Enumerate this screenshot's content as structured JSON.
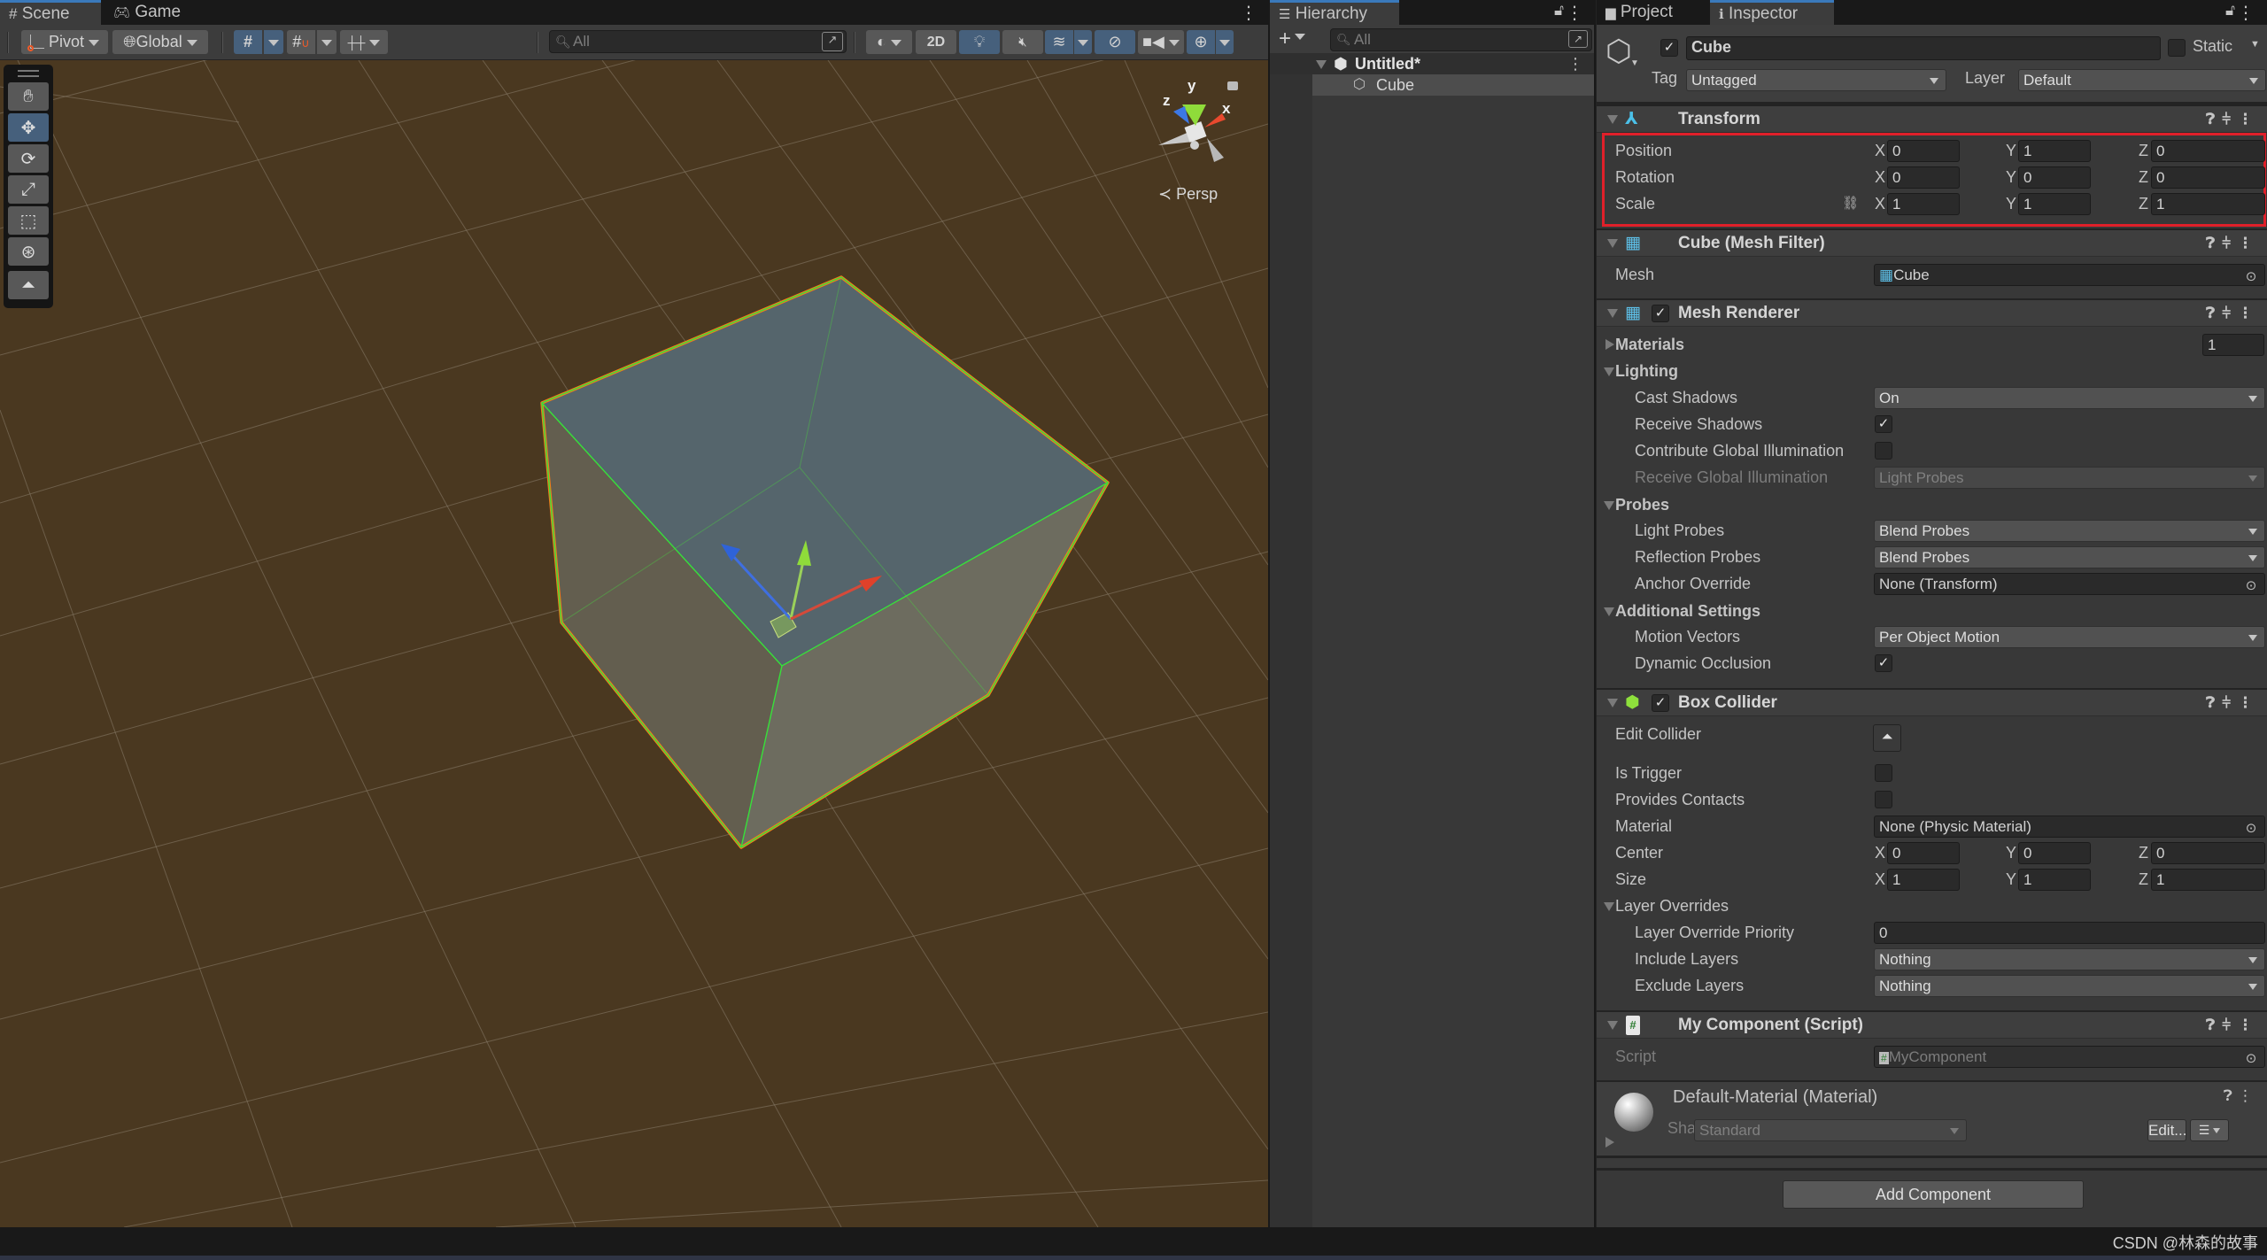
{
  "scene_window": {
    "tabs": [
      {
        "label": "Scene",
        "icon": "grid-hash-icon",
        "active": true
      },
      {
        "label": "Game",
        "icon": "gamepad-icon",
        "active": false
      }
    ],
    "toolbar": {
      "pivot_label": "Pivot",
      "global_label": "Global",
      "search_placeholder": "All",
      "mode_2d_label": "2D"
    },
    "tools": [
      "hand-tool",
      "move-tool",
      "rotate-tool",
      "scale-tool",
      "rect-tool",
      "transform-tool",
      "custom-editor-tool"
    ],
    "active_tool": "move-tool",
    "orientation_gizmo": {
      "x_label": "x",
      "y_label": "y",
      "z_label": "z",
      "projection_label": "Persp"
    },
    "viewport_colors": {
      "background": "#4a3820",
      "selection_outline": "#f27a1a",
      "collider_wire": "#37e13a"
    }
  },
  "hierarchy": {
    "tab_label": "Hierarchy",
    "search_placeholder": "All",
    "scene_name": "Untitled*",
    "items": [
      {
        "label": "Cube",
        "selected": true
      }
    ]
  },
  "inspector": {
    "tabs": [
      {
        "label": "Project",
        "active": false
      },
      {
        "label": "Inspector",
        "active": true
      }
    ],
    "object": {
      "active": true,
      "name": "Cube",
      "static_label": "Static",
      "static": false,
      "tag_label": "Tag",
      "tag_value": "Untagged",
      "layer_label": "Layer",
      "layer_value": "Default"
    },
    "transform": {
      "title": "Transform",
      "rows": [
        {
          "label": "Position",
          "x": "0",
          "y": "1",
          "z": "0"
        },
        {
          "label": "Rotation",
          "x": "0",
          "y": "0",
          "z": "0"
        },
        {
          "label": "Scale",
          "x": "1",
          "y": "1",
          "z": "1"
        }
      ],
      "highlight_color": "#e0202a"
    },
    "mesh_filter": {
      "title": "Cube (Mesh Filter)",
      "mesh_label": "Mesh",
      "mesh_value": "Cube"
    },
    "mesh_renderer": {
      "title": "Mesh Renderer",
      "enabled": true,
      "materials_label": "Materials",
      "materials_count": "1",
      "lighting_label": "Lighting",
      "cast_shadows_label": "Cast Shadows",
      "cast_shadows_value": "On",
      "receive_shadows_label": "Receive Shadows",
      "receive_shadows": true,
      "contribute_gi_label": "Contribute Global Illumination",
      "contribute_gi": false,
      "receive_gi_label": "Receive Global Illumination",
      "receive_gi_value": "Light Probes",
      "probes_label": "Probes",
      "light_probes_label": "Light Probes",
      "light_probes_value": "Blend Probes",
      "reflection_probes_label": "Reflection Probes",
      "reflection_probes_value": "Blend Probes",
      "anchor_override_label": "Anchor Override",
      "anchor_override_value": "None (Transform)",
      "additional_label": "Additional Settings",
      "motion_vectors_label": "Motion Vectors",
      "motion_vectors_value": "Per Object Motion",
      "dynamic_occlusion_label": "Dynamic Occlusion",
      "dynamic_occlusion": true
    },
    "box_collider": {
      "title": "Box Collider",
      "enabled": true,
      "edit_collider_label": "Edit Collider",
      "is_trigger_label": "Is Trigger",
      "is_trigger": false,
      "provides_contacts_label": "Provides Contacts",
      "provides_contacts": false,
      "material_label": "Material",
      "material_value": "None (Physic Material)",
      "center": {
        "label": "Center",
        "x": "0",
        "y": "0",
        "z": "0"
      },
      "size": {
        "label": "Size",
        "x": "1",
        "y": "1",
        "z": "1"
      },
      "layer_overrides_label": "Layer Overrides",
      "priority_label": "Layer Override Priority",
      "priority_value": "0",
      "include_layers_label": "Include Layers",
      "include_layers_value": "Nothing",
      "exclude_layers_label": "Exclude Layers",
      "exclude_layers_value": "Nothing"
    },
    "my_component": {
      "title": "My Component (Script)",
      "script_label": "Script",
      "script_value": "MyComponent"
    },
    "material": {
      "title": "Default-Material (Material)",
      "shader_label": "Shader",
      "shader_value": "Standard",
      "edit_label": "Edit..."
    },
    "add_component_label": "Add Component"
  },
  "status_bar": {
    "watermark": "CSDN @林森的故事"
  }
}
